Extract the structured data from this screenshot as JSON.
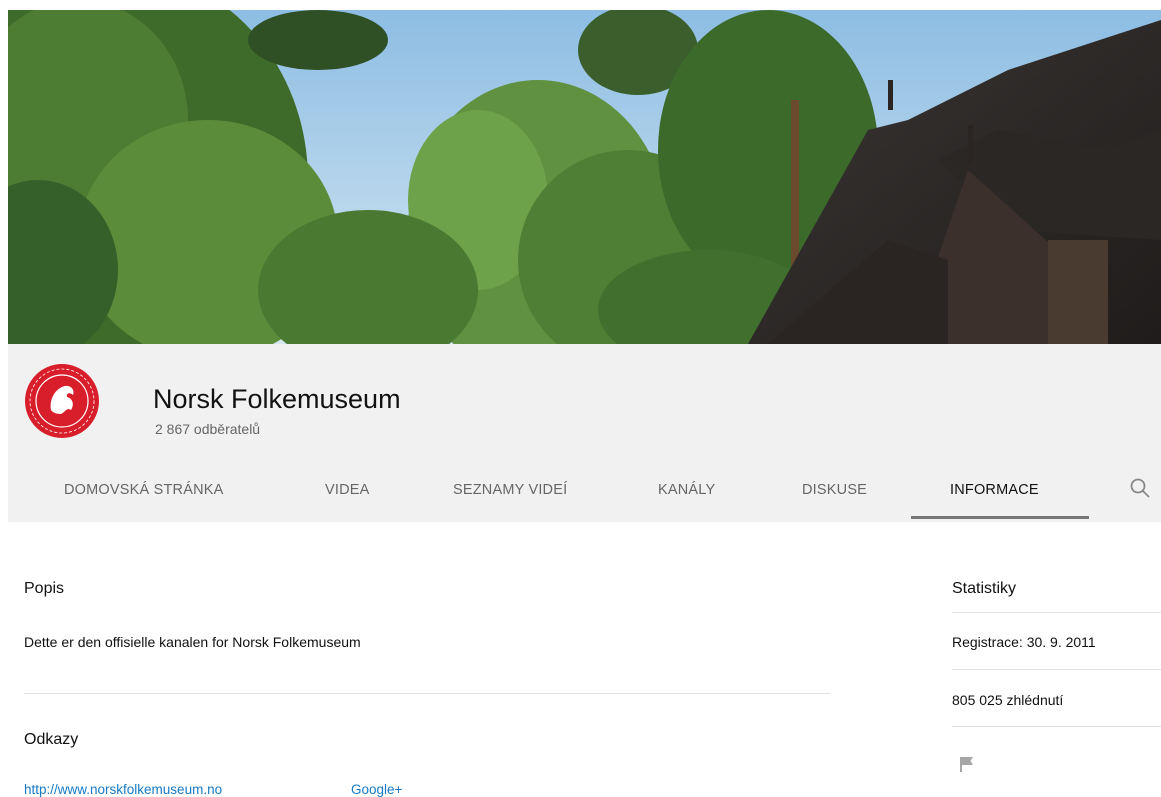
{
  "channel": {
    "name": "Norsk Folkemuseum",
    "subscribers": "2 867 odběratelů"
  },
  "tabs": [
    {
      "label": "DOMOVSKÁ STRÁNKA"
    },
    {
      "label": "VIDEA"
    },
    {
      "label": "SEZNAMY VIDEÍ"
    },
    {
      "label": "KANÁLY"
    },
    {
      "label": "DISKUSE"
    },
    {
      "label": "INFORMACE",
      "active": true
    }
  ],
  "about": {
    "description_heading": "Popis",
    "description": "Dette er den offisielle kanalen for Norsk Folkemuseum",
    "links_heading": "Odkazy",
    "links": [
      {
        "label": "http://www.norskfolkemuseum.no"
      },
      {
        "label": "Google+"
      }
    ]
  },
  "stats": {
    "heading": "Statistiky",
    "registered": "Registrace: 30. 9. 2011",
    "views": "805 025 zhlédnutí"
  },
  "colors": {
    "header_bg": "#f1f1f1",
    "link": "#167ac6",
    "logo_red": "#d81e2a"
  },
  "icons": [
    "search-icon",
    "flag-icon",
    "channel-logo"
  ]
}
